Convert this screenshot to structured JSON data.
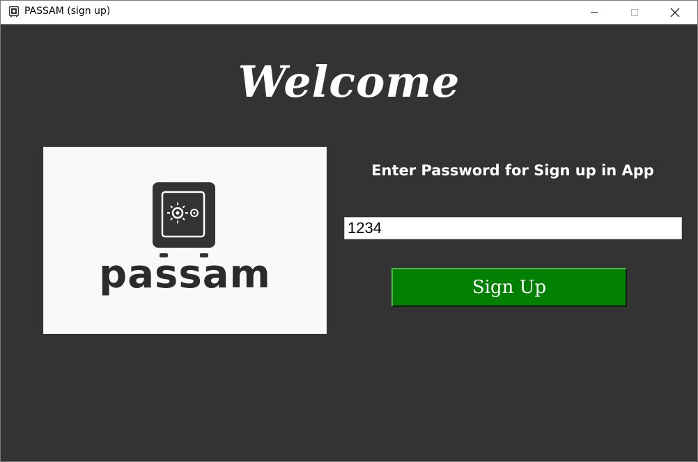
{
  "window": {
    "title": "PASSAM (sign up)"
  },
  "header": {
    "welcome_text": "Welcome"
  },
  "logo": {
    "brand_text": "passam",
    "icon": "safe-icon"
  },
  "form": {
    "prompt": "Enter Password for Sign up in App",
    "password_value": "1234",
    "signup_label": "Sign Up"
  },
  "colors": {
    "background": "#333333",
    "button_green": "#018001",
    "text": "#ffffff"
  }
}
